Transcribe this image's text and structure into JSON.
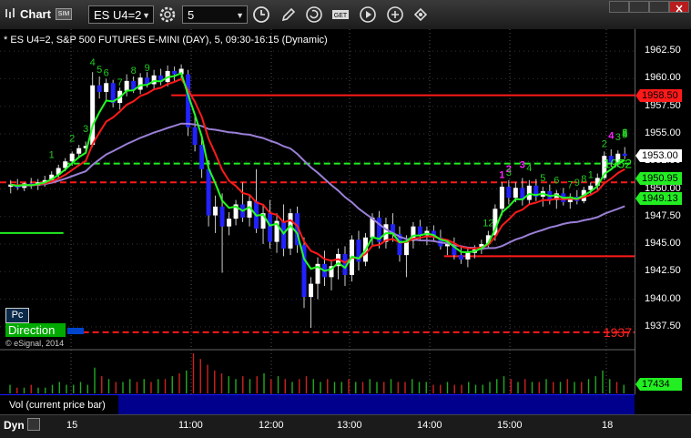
{
  "window": {
    "app_name": "Chart",
    "sim_badge": "SIM",
    "symbol": "ES U4=2",
    "interval": "5"
  },
  "chart": {
    "title": "* ES U4=2, S&P 500 FUTURES E-MINI (DAY), 5, 09:30-16:15 (Dynamic)",
    "watermark": "© eSignal, 2014",
    "pc_label": "Pc",
    "direction_label": "Direction",
    "volume_label": "Vol (current price bar)",
    "dyn_label": "Dyn",
    "colors": {
      "background": "#000000",
      "up_candle": "#ffffff",
      "down_candle": "#2222ff",
      "red_line": "#ff1a1a",
      "green_line": "#22ff22",
      "purple_line": "#9a7fd6"
    },
    "price_ticks": [
      "1962.50",
      "1960.00",
      "1957.50",
      "1955.00",
      "1952.50",
      "1950.00",
      "1947.50",
      "1945.00",
      "1942.50",
      "1940.00",
      "1937.50"
    ],
    "price_flags": [
      {
        "text": "1958.50",
        "bg": "#ff1a1a",
        "fg": "#000000"
      },
      {
        "text": "1953.00",
        "bg": "#ffffff",
        "fg": "#000000"
      },
      {
        "text": "1950.95",
        "bg": "#22ee22",
        "fg": "#000000"
      },
      {
        "text": "1949.13",
        "bg": "#22ee22",
        "fg": "#000000"
      },
      {
        "text": "17434",
        "bg": "#22ee22",
        "fg": "#000000"
      }
    ],
    "level_labels": [
      {
        "text": "1952",
        "color": "#22ee22"
      },
      {
        "text": "1937",
        "color": "#ff2222"
      }
    ],
    "time_ticks": [
      "15",
      "11:00",
      "12:00",
      "13:00",
      "14:00",
      "15:00",
      "18"
    ],
    "count_labels": [
      {
        "text": "1",
        "color": "#22cc22"
      },
      {
        "text": "2",
        "color": "#22cc22"
      },
      {
        "text": "3",
        "color": "#22cc22"
      },
      {
        "text": "4",
        "color": "#22cc22"
      },
      {
        "text": "5",
        "color": "#22cc22"
      },
      {
        "text": "6",
        "color": "#22cc22"
      },
      {
        "text": "7",
        "color": "#22cc22"
      },
      {
        "text": "8",
        "color": "#22cc22"
      },
      {
        "text": "9",
        "color": "#22cc22"
      },
      {
        "text": "1",
        "color": "#ff22ff"
      },
      {
        "text": "2",
        "color": "#ff22ff"
      },
      {
        "text": "3",
        "color": "#ff22ff"
      },
      {
        "text": "4",
        "color": "#ff22ff"
      },
      {
        "text": "12",
        "color": "#22cc22"
      },
      {
        "text": "3",
        "color": "#22cc22"
      },
      {
        "text": "4",
        "color": "#22cc22"
      },
      {
        "text": "5",
        "color": "#22cc22"
      },
      {
        "text": "6",
        "color": "#22cc22"
      },
      {
        "text": "7",
        "color": "#22cc22"
      },
      {
        "text": "8",
        "color": "#22cc22"
      },
      {
        "text": "9",
        "color": "#22cc22"
      },
      {
        "text": "1",
        "color": "#22cc22"
      },
      {
        "text": "2",
        "color": "#22cc22"
      },
      {
        "text": "3",
        "color": "#22cc22"
      },
      {
        "text": "4",
        "color": "#22cc22"
      },
      {
        "text": "5",
        "color": "#22cc22"
      },
      {
        "text": "6",
        "color": "#22cc22"
      },
      {
        "text": "7",
        "color": "#22cc22"
      },
      {
        "text": "8",
        "color": "#22cc22"
      }
    ]
  },
  "chart_data": {
    "type": "candlestick",
    "y_range": [
      1936,
      1964
    ],
    "candles": [
      [
        1950.2,
        1950.8,
        1949.6,
        1950.4
      ],
      [
        1950.4,
        1950.9,
        1949.9,
        1950.1
      ],
      [
        1950.1,
        1950.6,
        1949.8,
        1950.5
      ],
      [
        1950.5,
        1951.0,
        1950.0,
        1950.3
      ],
      [
        1950.3,
        1950.9,
        1949.9,
        1950.6
      ],
      [
        1950.6,
        1951.2,
        1950.2,
        1950.8
      ],
      [
        1950.8,
        1951.6,
        1950.6,
        1951.3
      ],
      [
        1951.3,
        1952.2,
        1951.0,
        1951.9
      ],
      [
        1951.9,
        1952.8,
        1951.6,
        1952.5
      ],
      [
        1952.5,
        1953.4,
        1952.1,
        1953.2
      ],
      [
        1953.2,
        1954.0,
        1952.8,
        1953.7
      ],
      [
        1953.7,
        1954.3,
        1953.2,
        1953.9
      ],
      [
        1954.0,
        1960.6,
        1953.8,
        1959.4
      ],
      [
        1959.4,
        1960.2,
        1958.2,
        1958.8
      ],
      [
        1958.8,
        1960.0,
        1958.0,
        1959.6
      ],
      [
        1959.6,
        1959.9,
        1957.4,
        1957.8
      ],
      [
        1957.8,
        1959.2,
        1957.2,
        1958.9
      ],
      [
        1958.9,
        1960.4,
        1958.4,
        1959.8
      ],
      [
        1959.8,
        1960.2,
        1958.7,
        1959.0
      ],
      [
        1959.0,
        1960.5,
        1958.6,
        1960.1
      ],
      [
        1960.1,
        1960.6,
        1959.2,
        1959.5
      ],
      [
        1959.5,
        1960.8,
        1959.0,
        1960.3
      ],
      [
        1960.3,
        1960.9,
        1959.4,
        1959.7
      ],
      [
        1959.7,
        1961.2,
        1959.3,
        1960.7
      ],
      [
        1960.7,
        1961.1,
        1959.8,
        1960.4
      ],
      [
        1960.4,
        1961.3,
        1959.9,
        1960.9
      ],
      [
        1960.4,
        1960.8,
        1954.8,
        1955.6
      ],
      [
        1955.6,
        1956.8,
        1953.4,
        1954.0
      ],
      [
        1954.0,
        1955.0,
        1951.0,
        1951.8
      ],
      [
        1951.8,
        1952.6,
        1946.6,
        1947.6
      ],
      [
        1947.6,
        1949.4,
        1946.0,
        1948.4
      ],
      [
        1948.4,
        1949.6,
        1942.4,
        1946.6
      ],
      [
        1946.6,
        1947.9,
        1945.8,
        1947.3
      ],
      [
        1947.3,
        1949.0,
        1946.7,
        1948.6
      ],
      [
        1948.6,
        1950.6,
        1947.0,
        1947.4
      ],
      [
        1947.4,
        1949.4,
        1946.6,
        1948.9
      ],
      [
        1948.9,
        1951.8,
        1946.0,
        1946.4
      ],
      [
        1946.4,
        1948.6,
        1945.0,
        1947.8
      ],
      [
        1947.8,
        1949.0,
        1944.6,
        1945.2
      ],
      [
        1945.2,
        1947.8,
        1944.2,
        1947.1
      ],
      [
        1947.1,
        1948.6,
        1943.9,
        1944.6
      ],
      [
        1944.6,
        1948.2,
        1944.0,
        1947.8
      ],
      [
        1947.8,
        1948.4,
        1944.2,
        1944.9
      ],
      [
        1944.9,
        1945.6,
        1939.2,
        1940.2
      ],
      [
        1940.2,
        1942.0,
        1937.4,
        1941.4
      ],
      [
        1941.4,
        1943.8,
        1940.0,
        1943.2
      ],
      [
        1943.2,
        1944.4,
        1941.2,
        1942.0
      ],
      [
        1942.0,
        1943.6,
        1940.8,
        1943.0
      ],
      [
        1943.0,
        1944.6,
        1941.8,
        1944.1
      ],
      [
        1944.1,
        1944.8,
        1941.2,
        1942.2
      ],
      [
        1942.2,
        1945.8,
        1941.6,
        1945.4
      ],
      [
        1945.4,
        1946.2,
        1942.6,
        1943.4
      ],
      [
        1943.4,
        1946.0,
        1943.0,
        1945.6
      ],
      [
        1945.6,
        1947.8,
        1944.8,
        1947.4
      ],
      [
        1947.4,
        1948.0,
        1944.6,
        1945.2
      ],
      [
        1945.2,
        1947.4,
        1944.6,
        1946.8
      ],
      [
        1946.8,
        1947.8,
        1945.2,
        1945.9
      ],
      [
        1945.9,
        1946.6,
        1943.4,
        1944.0
      ],
      [
        1944.0,
        1945.8,
        1942.0,
        1945.3
      ],
      [
        1945.3,
        1947.0,
        1944.6,
        1946.6
      ],
      [
        1946.6,
        1947.2,
        1945.4,
        1945.8
      ],
      [
        1945.8,
        1946.6,
        1944.9,
        1946.2
      ],
      [
        1946.2,
        1946.7,
        1945.2,
        1945.6
      ],
      [
        1945.6,
        1946.3,
        1944.5,
        1944.8
      ],
      [
        1944.8,
        1945.4,
        1944.0,
        1945.0
      ],
      [
        1945.0,
        1945.6,
        1943.6,
        1944.0
      ],
      [
        1944.0,
        1944.8,
        1943.2,
        1943.6
      ],
      [
        1943.6,
        1944.6,
        1942.9,
        1944.2
      ],
      [
        1944.2,
        1944.9,
        1943.7,
        1944.5
      ],
      [
        1944.5,
        1945.4,
        1944.1,
        1945.0
      ],
      [
        1945.0,
        1946.2,
        1944.7,
        1945.8
      ],
      [
        1945.8,
        1948.6,
        1945.3,
        1948.2
      ],
      [
        1948.2,
        1950.6,
        1947.6,
        1950.2
      ],
      [
        1950.2,
        1950.8,
        1948.6,
        1949.2
      ],
      [
        1949.2,
        1950.6,
        1948.8,
        1950.1
      ],
      [
        1950.1,
        1951.0,
        1948.5,
        1949.0
      ],
      [
        1949.0,
        1950.8,
        1948.6,
        1950.3
      ],
      [
        1950.3,
        1950.9,
        1948.9,
        1949.3
      ],
      [
        1949.3,
        1950.2,
        1948.4,
        1949.8
      ],
      [
        1949.8,
        1950.4,
        1948.6,
        1949.0
      ],
      [
        1949.0,
        1949.9,
        1948.2,
        1949.6
      ],
      [
        1949.6,
        1950.1,
        1948.5,
        1948.8
      ],
      [
        1948.8,
        1949.6,
        1948.2,
        1949.3
      ],
      [
        1949.3,
        1949.9,
        1948.6,
        1948.9
      ],
      [
        1948.9,
        1950.2,
        1948.7,
        1949.9
      ],
      [
        1949.9,
        1950.6,
        1949.4,
        1950.3
      ],
      [
        1950.3,
        1951.4,
        1949.9,
        1951.0
      ],
      [
        1951.0,
        1953.4,
        1950.8,
        1953.0
      ],
      [
        1953.0,
        1953.6,
        1952.0,
        1952.4
      ],
      [
        1952.4,
        1953.5,
        1952.0,
        1953.2
      ],
      [
        1953.2,
        1953.8,
        1952.7,
        1953.0
      ]
    ],
    "volumes": [
      3,
      2,
      2,
      3,
      2,
      2,
      3,
      4,
      3,
      3,
      4,
      3,
      9,
      6,
      5,
      4,
      4,
      5,
      4,
      5,
      4,
      5,
      5,
      6,
      7,
      8,
      14,
      12,
      10,
      8,
      7,
      6,
      5,
      6,
      5,
      6,
      7,
      5,
      6,
      5,
      4,
      5,
      6,
      5,
      4,
      5,
      4,
      4,
      5,
      4,
      4,
      5,
      4,
      4,
      5,
      4,
      4,
      5,
      4,
      4,
      3,
      3,
      4,
      3,
      3,
      4,
      3,
      3,
      4,
      5,
      6,
      5,
      4,
      5,
      4,
      4,
      5,
      4,
      4,
      5,
      4,
      4,
      5,
      6,
      8,
      5,
      4,
      3
    ],
    "levels": [
      {
        "price": 1958.5,
        "color": "#ff1a1a",
        "style": "solid",
        "from": 0.27
      },
      {
        "price": 1952.3,
        "color": "#22ee22",
        "style": "dashed",
        "from": 0.1
      },
      {
        "price": 1950.6,
        "color": "#ff1a1a",
        "style": "dashed",
        "from": 0.0
      },
      {
        "price": 1943.9,
        "color": "#ff1a1a",
        "style": "solid",
        "from": 0.7
      },
      {
        "price": 1937.0,
        "color": "#ff1a1a",
        "style": "dashed",
        "from": 0.13
      },
      {
        "price": 1946.0,
        "color": "#22ee22",
        "style": "solid",
        "from": 0.0,
        "to": 0.1
      }
    ]
  }
}
